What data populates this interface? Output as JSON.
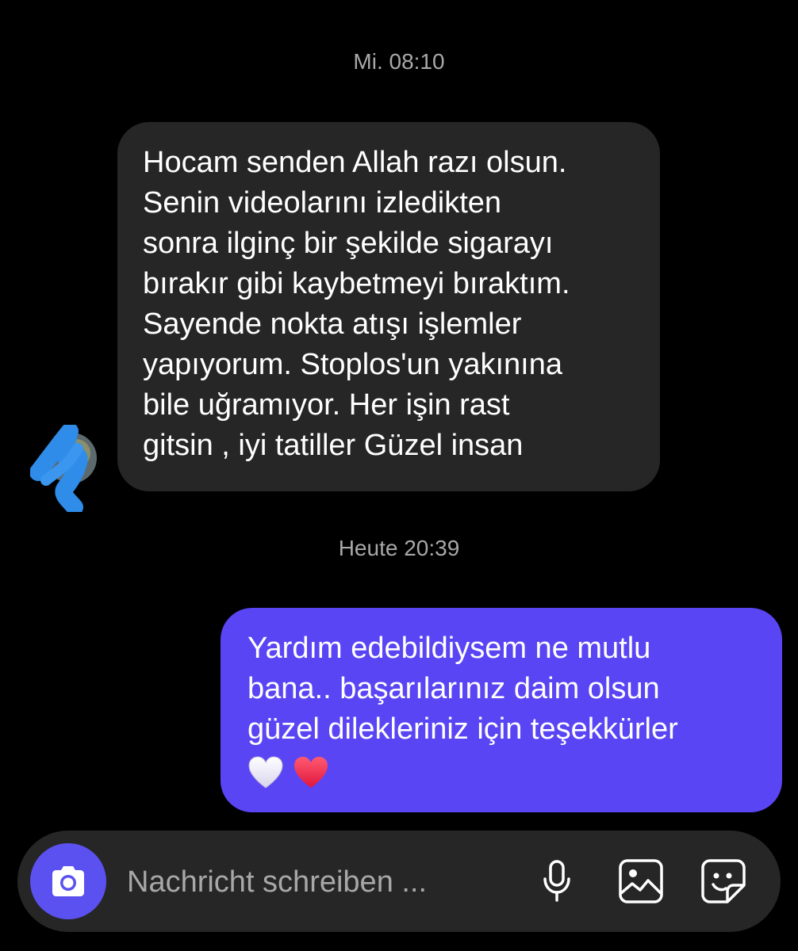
{
  "thread": {
    "timestamp_1": "Mi. 08:10",
    "timestamp_2": "Heute 20:39"
  },
  "messages": [
    {
      "direction": "incoming",
      "lines": [
        "Hocam senden Allah razı olsun.",
        "Senin videolarını izledikten",
        "sonra ilginç bir şekilde sigarayı",
        "bırakır gibi kaybetmeyi bıraktım.",
        "Sayende nokta atışı işlemler",
        "yapıyorum. Stoplos'un yakınına",
        "bile uğramıyor. Her işin rast",
        "gitsin , iyi tatiller Güzel insan"
      ]
    },
    {
      "direction": "outgoing",
      "lines": [
        "Yardım edebildiysem ne mutlu",
        "bana.. başarılarınız daim olsun",
        "güzel dilekleriniz için teşekkürler"
      ],
      "emoji": [
        "white-heart",
        "red-heart"
      ]
    }
  ],
  "composer": {
    "placeholder": "Nachricht schreiben ...",
    "icons": [
      "camera-icon",
      "microphone-icon",
      "gallery-icon",
      "sticker-icon"
    ]
  },
  "colors": {
    "background": "#000000",
    "incoming_bubble": "#262626",
    "outgoing_bubble": "#5a45f5",
    "camera_button": "#5b51f0",
    "timestamp_text": "#a8a8a8"
  }
}
